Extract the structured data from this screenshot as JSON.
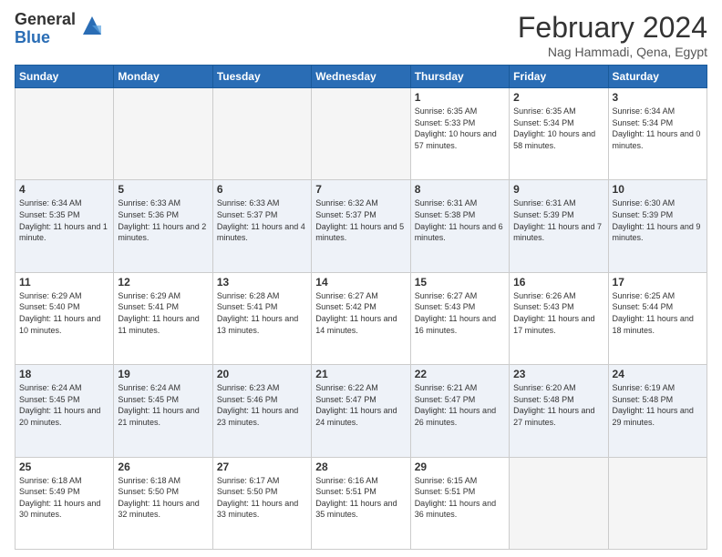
{
  "header": {
    "logo_general": "General",
    "logo_blue": "Blue",
    "title": "February 2024",
    "location": "Nag Hammadi, Qena, Egypt"
  },
  "days_of_week": [
    "Sunday",
    "Monday",
    "Tuesday",
    "Wednesday",
    "Thursday",
    "Friday",
    "Saturday"
  ],
  "weeks": [
    [
      {
        "day": "",
        "info": ""
      },
      {
        "day": "",
        "info": ""
      },
      {
        "day": "",
        "info": ""
      },
      {
        "day": "",
        "info": ""
      },
      {
        "day": "1",
        "info": "Sunrise: 6:35 AM\nSunset: 5:33 PM\nDaylight: 10 hours and 57 minutes."
      },
      {
        "day": "2",
        "info": "Sunrise: 6:35 AM\nSunset: 5:34 PM\nDaylight: 10 hours and 58 minutes."
      },
      {
        "day": "3",
        "info": "Sunrise: 6:34 AM\nSunset: 5:34 PM\nDaylight: 11 hours and 0 minutes."
      }
    ],
    [
      {
        "day": "4",
        "info": "Sunrise: 6:34 AM\nSunset: 5:35 PM\nDaylight: 11 hours and 1 minute."
      },
      {
        "day": "5",
        "info": "Sunrise: 6:33 AM\nSunset: 5:36 PM\nDaylight: 11 hours and 2 minutes."
      },
      {
        "day": "6",
        "info": "Sunrise: 6:33 AM\nSunset: 5:37 PM\nDaylight: 11 hours and 4 minutes."
      },
      {
        "day": "7",
        "info": "Sunrise: 6:32 AM\nSunset: 5:37 PM\nDaylight: 11 hours and 5 minutes."
      },
      {
        "day": "8",
        "info": "Sunrise: 6:31 AM\nSunset: 5:38 PM\nDaylight: 11 hours and 6 minutes."
      },
      {
        "day": "9",
        "info": "Sunrise: 6:31 AM\nSunset: 5:39 PM\nDaylight: 11 hours and 7 minutes."
      },
      {
        "day": "10",
        "info": "Sunrise: 6:30 AM\nSunset: 5:39 PM\nDaylight: 11 hours and 9 minutes."
      }
    ],
    [
      {
        "day": "11",
        "info": "Sunrise: 6:29 AM\nSunset: 5:40 PM\nDaylight: 11 hours and 10 minutes."
      },
      {
        "day": "12",
        "info": "Sunrise: 6:29 AM\nSunset: 5:41 PM\nDaylight: 11 hours and 11 minutes."
      },
      {
        "day": "13",
        "info": "Sunrise: 6:28 AM\nSunset: 5:41 PM\nDaylight: 11 hours and 13 minutes."
      },
      {
        "day": "14",
        "info": "Sunrise: 6:27 AM\nSunset: 5:42 PM\nDaylight: 11 hours and 14 minutes."
      },
      {
        "day": "15",
        "info": "Sunrise: 6:27 AM\nSunset: 5:43 PM\nDaylight: 11 hours and 16 minutes."
      },
      {
        "day": "16",
        "info": "Sunrise: 6:26 AM\nSunset: 5:43 PM\nDaylight: 11 hours and 17 minutes."
      },
      {
        "day": "17",
        "info": "Sunrise: 6:25 AM\nSunset: 5:44 PM\nDaylight: 11 hours and 18 minutes."
      }
    ],
    [
      {
        "day": "18",
        "info": "Sunrise: 6:24 AM\nSunset: 5:45 PM\nDaylight: 11 hours and 20 minutes."
      },
      {
        "day": "19",
        "info": "Sunrise: 6:24 AM\nSunset: 5:45 PM\nDaylight: 11 hours and 21 minutes."
      },
      {
        "day": "20",
        "info": "Sunrise: 6:23 AM\nSunset: 5:46 PM\nDaylight: 11 hours and 23 minutes."
      },
      {
        "day": "21",
        "info": "Sunrise: 6:22 AM\nSunset: 5:47 PM\nDaylight: 11 hours and 24 minutes."
      },
      {
        "day": "22",
        "info": "Sunrise: 6:21 AM\nSunset: 5:47 PM\nDaylight: 11 hours and 26 minutes."
      },
      {
        "day": "23",
        "info": "Sunrise: 6:20 AM\nSunset: 5:48 PM\nDaylight: 11 hours and 27 minutes."
      },
      {
        "day": "24",
        "info": "Sunrise: 6:19 AM\nSunset: 5:48 PM\nDaylight: 11 hours and 29 minutes."
      }
    ],
    [
      {
        "day": "25",
        "info": "Sunrise: 6:18 AM\nSunset: 5:49 PM\nDaylight: 11 hours and 30 minutes."
      },
      {
        "day": "26",
        "info": "Sunrise: 6:18 AM\nSunset: 5:50 PM\nDaylight: 11 hours and 32 minutes."
      },
      {
        "day": "27",
        "info": "Sunrise: 6:17 AM\nSunset: 5:50 PM\nDaylight: 11 hours and 33 minutes."
      },
      {
        "day": "28",
        "info": "Sunrise: 6:16 AM\nSunset: 5:51 PM\nDaylight: 11 hours and 35 minutes."
      },
      {
        "day": "29",
        "info": "Sunrise: 6:15 AM\nSunset: 5:51 PM\nDaylight: 11 hours and 36 minutes."
      },
      {
        "day": "",
        "info": ""
      },
      {
        "day": "",
        "info": ""
      }
    ]
  ]
}
